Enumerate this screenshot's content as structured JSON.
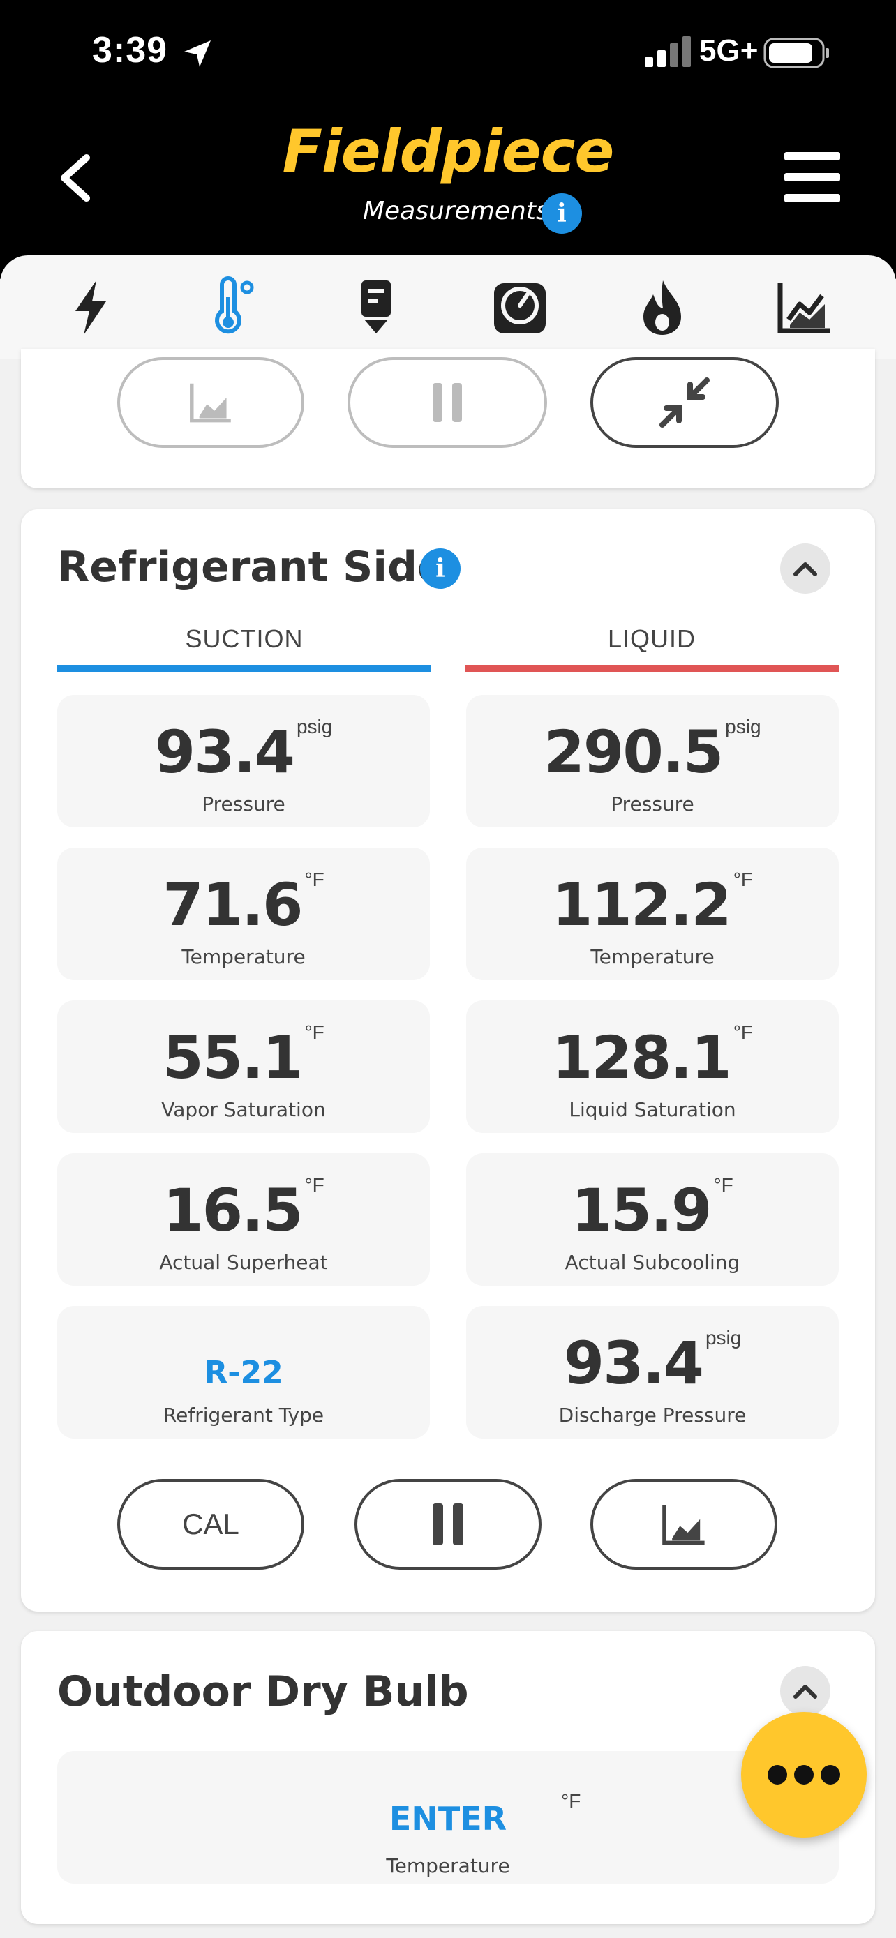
{
  "status_bar": {
    "time": "3:39",
    "network": "5G+"
  },
  "header": {
    "logo": "Fieldpiece",
    "subtitle": "Measurements",
    "info_icon_glyph": "i"
  },
  "tabs": [
    {
      "icon": "lightning-bolt-icon",
      "active": false
    },
    {
      "icon": "thermometer-icon",
      "active": true
    },
    {
      "icon": "probe-icon",
      "active": false
    },
    {
      "icon": "gauge-icon",
      "active": false
    },
    {
      "icon": "flame-icon",
      "active": false
    },
    {
      "icon": "chart-trend-icon",
      "active": false
    }
  ],
  "colors": {
    "accent_blue": "#1D8FE1",
    "brand_yellow": "#FFC72C",
    "liquid_red": "#E05555"
  },
  "refrigerant_side": {
    "title": "Refrigerant Side",
    "info_glyph": "i",
    "suction_label": "SUCTION",
    "liquid_label": "LIQUID",
    "suction": [
      {
        "value": "93.4",
        "unit": "psig",
        "label": "Pressure"
      },
      {
        "value": "71.6",
        "unit": "°F",
        "label": "Temperature"
      },
      {
        "value": "55.1",
        "unit": "°F",
        "label": "Vapor Saturation"
      },
      {
        "value": "16.5",
        "unit": "°F",
        "label": "Actual Superheat"
      }
    ],
    "refrigerant_type": {
      "value": "R-22",
      "label": "Refrigerant Type"
    },
    "liquid": [
      {
        "value": "290.5",
        "unit": "psig",
        "label": "Pressure"
      },
      {
        "value": "112.2",
        "unit": "°F",
        "label": "Temperature"
      },
      {
        "value": "128.1",
        "unit": "°F",
        "label": "Liquid Saturation"
      },
      {
        "value": "15.9",
        "unit": "°F",
        "label": "Actual Subcooling"
      },
      {
        "value": "93.4",
        "unit": "psig",
        "label": "Discharge Pressure"
      }
    ],
    "buttons": {
      "cal_label": "CAL"
    }
  },
  "outdoor_dry_bulb": {
    "title": "Outdoor Dry Bulb",
    "value": "ENTER",
    "unit": "°F",
    "label": "Temperature"
  }
}
